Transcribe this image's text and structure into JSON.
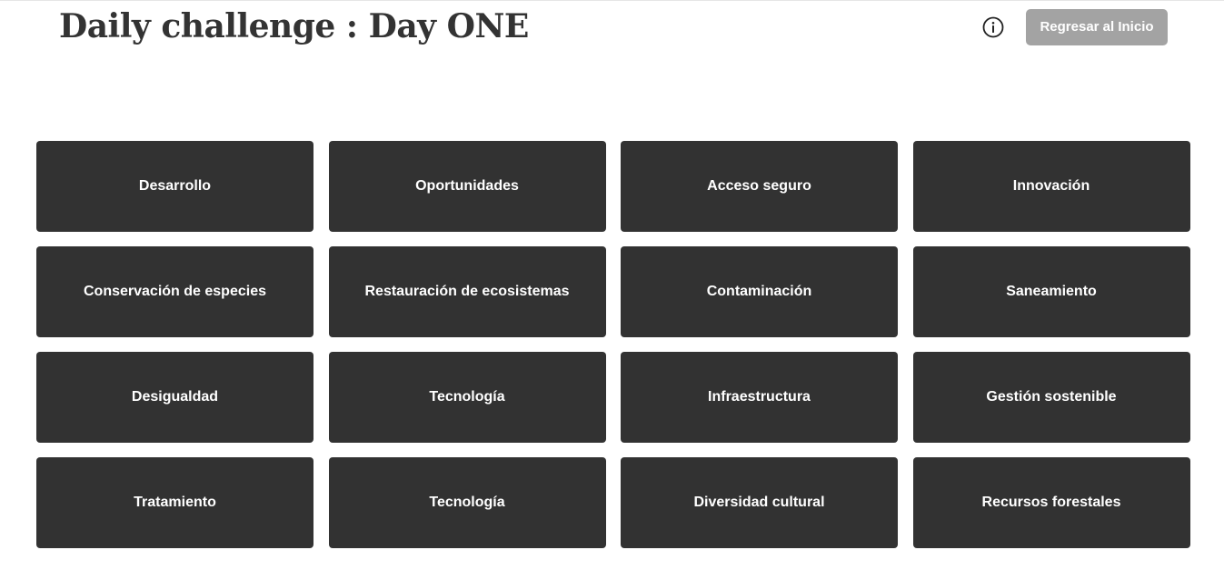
{
  "header": {
    "title": "Daily challenge : Day ONE",
    "info_icon": "info-circle-icon",
    "home_button_label": "Regresar al Inicio"
  },
  "colors": {
    "tile_background": "#323232",
    "tile_text": "#ffffff",
    "home_button_background": "#a3a3a3",
    "title_text": "#333333"
  },
  "tiles": [
    "Desarrollo",
    "Oportunidades",
    "Acceso seguro",
    "Innovación",
    "Conservación de especies",
    "Restauración de ecosistemas",
    "Contaminación",
    "Saneamiento",
    "Desigualdad",
    "Tecnología",
    "Infraestructura",
    "Gestión sostenible",
    "Tratamiento",
    "Tecnología",
    "Diversidad cultural",
    "Recursos forestales"
  ]
}
